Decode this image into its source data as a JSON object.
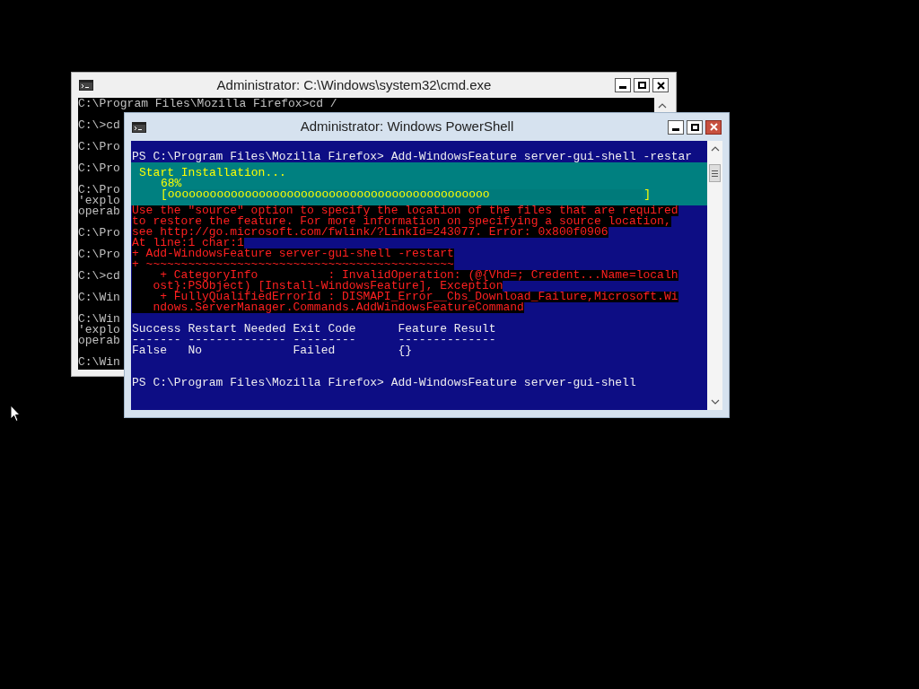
{
  "cmd_window": {
    "title": "Administrator: C:\\Windows\\system32\\cmd.exe",
    "blocks": [
      [
        "C:\\Program Files\\Mozilla Firefox>cd /"
      ],
      [
        "C:\\>cd"
      ],
      [
        "C:\\Pro"
      ],
      [
        "C:\\Pro"
      ],
      [
        "C:\\Pro",
        "'explo",
        "operab"
      ],
      [
        "C:\\Pro"
      ],
      [
        "C:\\Pro"
      ],
      [
        "C:\\>cd"
      ],
      [
        "C:\\Win"
      ],
      [
        "C:\\Win",
        "'explo",
        "operab"
      ],
      [
        "C:\\Win"
      ]
    ]
  },
  "powershell_window": {
    "title": "Administrator: Windows PowerShell",
    "lines": [
      {
        "kind": "prompt",
        "text": "PS C:\\Program Files\\Mozilla Firefox> Add-WindowsFeature server-gui-shell -restar"
      },
      {
        "kind": "progress",
        "status": "Start Installation...",
        "percent": "68%",
        "bar_open": "[",
        "fill": "oooooooooooooooooooooooooooooooooooooooooooooo",
        "bar_close": "]",
        "level": 0.68
      },
      {
        "kind": "error",
        "lines": [
          "Use the \"source\" option to specify the location of the files that are required",
          "to restore the feature. For more information on specifying a source location,",
          "see http://go.microsoft.com/fwlink/?LinkId=243077. Error: 0x800f0906",
          "At line:1 char:1",
          "+ Add-WindowsFeature server-gui-shell -restart",
          "+ ~~~~~~~~~~~~~~~~~~~~~~~~~~~~~~~~~~~~~~~~~~~~",
          "    + CategoryInfo          : InvalidOperation: (@{Vhd=; Credent...Name=localh",
          "   ost}:PSObject) [Install-WindowsFeature], Exception",
          "    + FullyQualifiedErrorId : DISMAPI_Error__Cbs_Download_Failure,Microsoft.Wi",
          "   ndows.ServerManager.Commands.AddWindowsFeatureCommand"
        ]
      },
      {
        "kind": "output",
        "lines": [
          "Success Restart Needed Exit Code      Feature Result",
          "------- -------------- ---------      --------------",
          "False   No             Failed         {}"
        ]
      },
      {
        "kind": "prompt",
        "text": "PS C:\\Program Files\\Mozilla Firefox> Add-WindowsFeature server-gui-shell"
      }
    ]
  }
}
